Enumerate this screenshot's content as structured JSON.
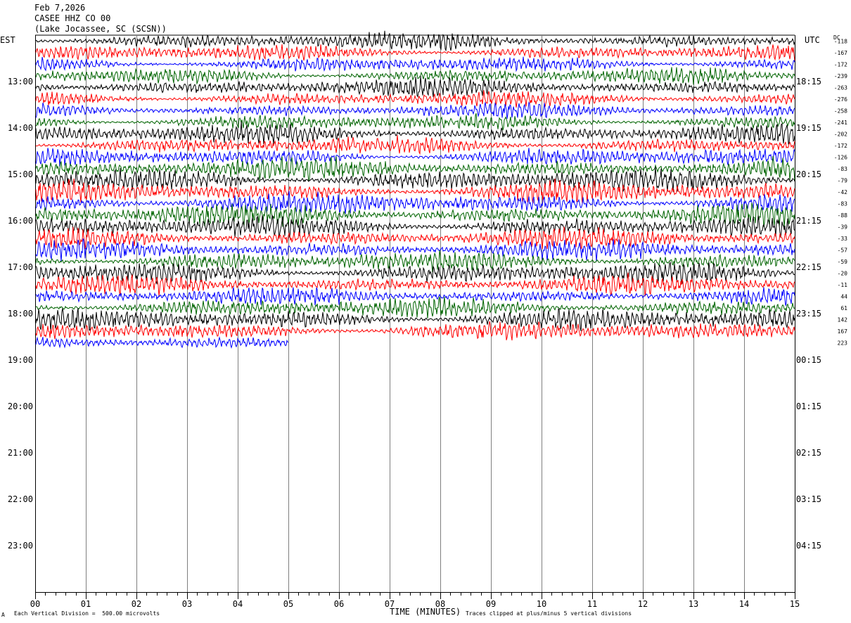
{
  "header": {
    "date": "Feb 7,2026",
    "station": "CASEE HHZ CO 00",
    "location": "(Lake Jocassee, SC (SCSN))"
  },
  "axes": {
    "left_label": "EST",
    "right_label": "UTC",
    "dc_label": "DC",
    "xlabel": "TIME (MINUTES)",
    "scale_note": "Each Vertical Division =  500.00 microvolts",
    "clip_note": "Traces clipped at plus/minus 5 vertical divisions",
    "corner_mark": "A"
  },
  "colors": {
    "trace_cycle": [
      "#000000",
      "#ff0000",
      "#0000ff",
      "#006400"
    ],
    "grid": "#7f7f7f"
  },
  "chart_data": {
    "type": "line",
    "title": "CASEE HHZ CO 00",
    "xlim": [
      0,
      15
    ],
    "x_ticks": [
      "00",
      "01",
      "02",
      "03",
      "04",
      "05",
      "06",
      "07",
      "08",
      "09",
      "10",
      "11",
      "12",
      "13",
      "14",
      "15"
    ],
    "est_hour_labels": [
      "13:00",
      "14:00",
      "15:00",
      "16:00",
      "17:00",
      "18:00",
      "19:00",
      "20:00",
      "21:00",
      "22:00",
      "23:00"
    ],
    "utc_hour_labels": [
      "18:15",
      "19:15",
      "20:15",
      "21:15",
      "22:15",
      "23:15",
      "00:15",
      "01:15",
      "02:15",
      "03:15",
      "04:15"
    ],
    "row_minutes": 15,
    "rows_total": 48,
    "first_hour_row": 4,
    "traces_recorded": 27,
    "last_trace_end_minute": 5,
    "dc_offsets": [
      -118,
      -167,
      -172,
      -239,
      -263,
      -276,
      -258,
      -241,
      -202,
      -172,
      -126,
      -83,
      -79,
      -42,
      -83,
      -88,
      -39,
      -33,
      -57,
      -59,
      -20,
      -11,
      44,
      61,
      142,
      167,
      223
    ],
    "trace_amplitude_divisions": [
      0.9,
      0.8,
      0.8,
      0.8,
      1.0,
      0.8,
      0.8,
      0.8,
      1.0,
      0.9,
      0.9,
      1.1,
      1.2,
      1.1,
      1.1,
      1.1,
      1.1,
      1.0,
      1.0,
      1.0,
      1.1,
      1.0,
      0.9,
      1.0,
      1.1,
      1.0,
      0.8
    ]
  }
}
